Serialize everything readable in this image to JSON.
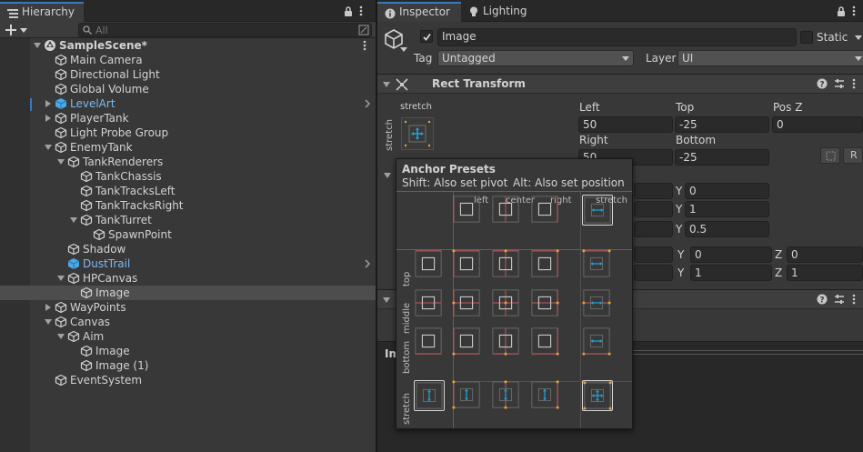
{
  "hierarchy": {
    "tab_label": "Hierarchy",
    "search_placeholder": "All",
    "items": [
      {
        "label": "SampleScene*",
        "depth": 0,
        "fold": "open",
        "icon": "unity-scene",
        "bold": true,
        "menu": true
      },
      {
        "label": "Main Camera",
        "depth": 1,
        "fold": "none",
        "icon": "gameobject"
      },
      {
        "label": "Directional Light",
        "depth": 1,
        "fold": "none",
        "icon": "gameobject"
      },
      {
        "label": "Global Volume",
        "depth": 1,
        "fold": "none",
        "icon": "gameobject"
      },
      {
        "label": "LevelArt",
        "depth": 1,
        "fold": "closed",
        "icon": "prefab",
        "blue": true,
        "chevron": true
      },
      {
        "label": "PlayerTank",
        "depth": 1,
        "fold": "closed",
        "icon": "gameobject"
      },
      {
        "label": "Light Probe Group",
        "depth": 1,
        "fold": "none",
        "icon": "gameobject"
      },
      {
        "label": "EnemyTank",
        "depth": 1,
        "fold": "open",
        "icon": "gameobject"
      },
      {
        "label": "TankRenderers",
        "depth": 2,
        "fold": "open",
        "icon": "gameobject"
      },
      {
        "label": "TankChassis",
        "depth": 3,
        "fold": "none",
        "icon": "gameobject"
      },
      {
        "label": "TankTracksLeft",
        "depth": 3,
        "fold": "none",
        "icon": "gameobject"
      },
      {
        "label": "TankTracksRight",
        "depth": 3,
        "fold": "none",
        "icon": "gameobject"
      },
      {
        "label": "TankTurret",
        "depth": 3,
        "fold": "open",
        "icon": "gameobject"
      },
      {
        "label": "SpawnPoint",
        "depth": 4,
        "fold": "none",
        "icon": "gameobject"
      },
      {
        "label": "Shadow",
        "depth": 2,
        "fold": "none",
        "icon": "gameobject"
      },
      {
        "label": "DustTrail",
        "depth": 2,
        "fold": "none",
        "icon": "prefab",
        "blue": true,
        "chevron": true
      },
      {
        "label": "HPCanvas",
        "depth": 2,
        "fold": "open",
        "icon": "gameobject"
      },
      {
        "label": "Image",
        "depth": 3,
        "fold": "none",
        "icon": "gameobject",
        "selected": true
      },
      {
        "label": "WayPoints",
        "depth": 1,
        "fold": "closed",
        "icon": "gameobject"
      },
      {
        "label": "Canvas",
        "depth": 1,
        "fold": "open",
        "icon": "gameobject"
      },
      {
        "label": "Aim",
        "depth": 2,
        "fold": "open",
        "icon": "gameobject"
      },
      {
        "label": "Image",
        "depth": 3,
        "fold": "none",
        "icon": "gameobject"
      },
      {
        "label": "Image (1)",
        "depth": 3,
        "fold": "none",
        "icon": "gameobject"
      },
      {
        "label": "EventSystem",
        "depth": 1,
        "fold": "none",
        "icon": "gameobject"
      }
    ]
  },
  "inspector": {
    "tabs": [
      "Inspector",
      "Lighting"
    ],
    "object_name": "Image",
    "static_label": "Static",
    "tag_label": "Tag",
    "tag_value": "Untagged",
    "layer_label": "Layer",
    "layer_value": "UI",
    "rect_transform_title": "Rect Transform",
    "anchor_mode": "stretch",
    "anchor_side_label": "stretch",
    "fields": {
      "left_label": "Left",
      "left_value": "50",
      "top_label": "Top",
      "top_value": "-25",
      "posz_label": "Pos Z",
      "posz_value": "0",
      "right_label": "Right",
      "right_value": "50",
      "bottom_label": "Bottom",
      "bottom_value": "-25",
      "r_button": "R"
    },
    "rows": [
      {
        "y_label": "Y",
        "y_value": "0"
      },
      {
        "y_label": "Y",
        "y_value": "1"
      },
      {
        "y_label": "Y",
        "y_value": "0.5"
      }
    ],
    "rot_row": {
      "y_label": "Y",
      "y_value": "0",
      "z_label": "Z",
      "z_value": "0"
    },
    "scale_row": {
      "y_label": "Y",
      "y_value": "1",
      "z_label": "Z",
      "z_value": "1"
    },
    "partial_label": "Im"
  },
  "anchor_presets": {
    "title": "Anchor Presets",
    "hint_shift": "Shift: Also set pivot",
    "hint_alt": "Alt: Also set position",
    "columns": [
      "left",
      "center",
      "right",
      "stretch"
    ],
    "rows": [
      "top",
      "middle",
      "bottom",
      "stretch"
    ]
  },
  "colors": {
    "accent_blue": "#7cb9ee",
    "anchor_red": "#c9595f",
    "anchor_orange": "#e7a23a",
    "anchor_cyan": "#1ea3d8"
  }
}
